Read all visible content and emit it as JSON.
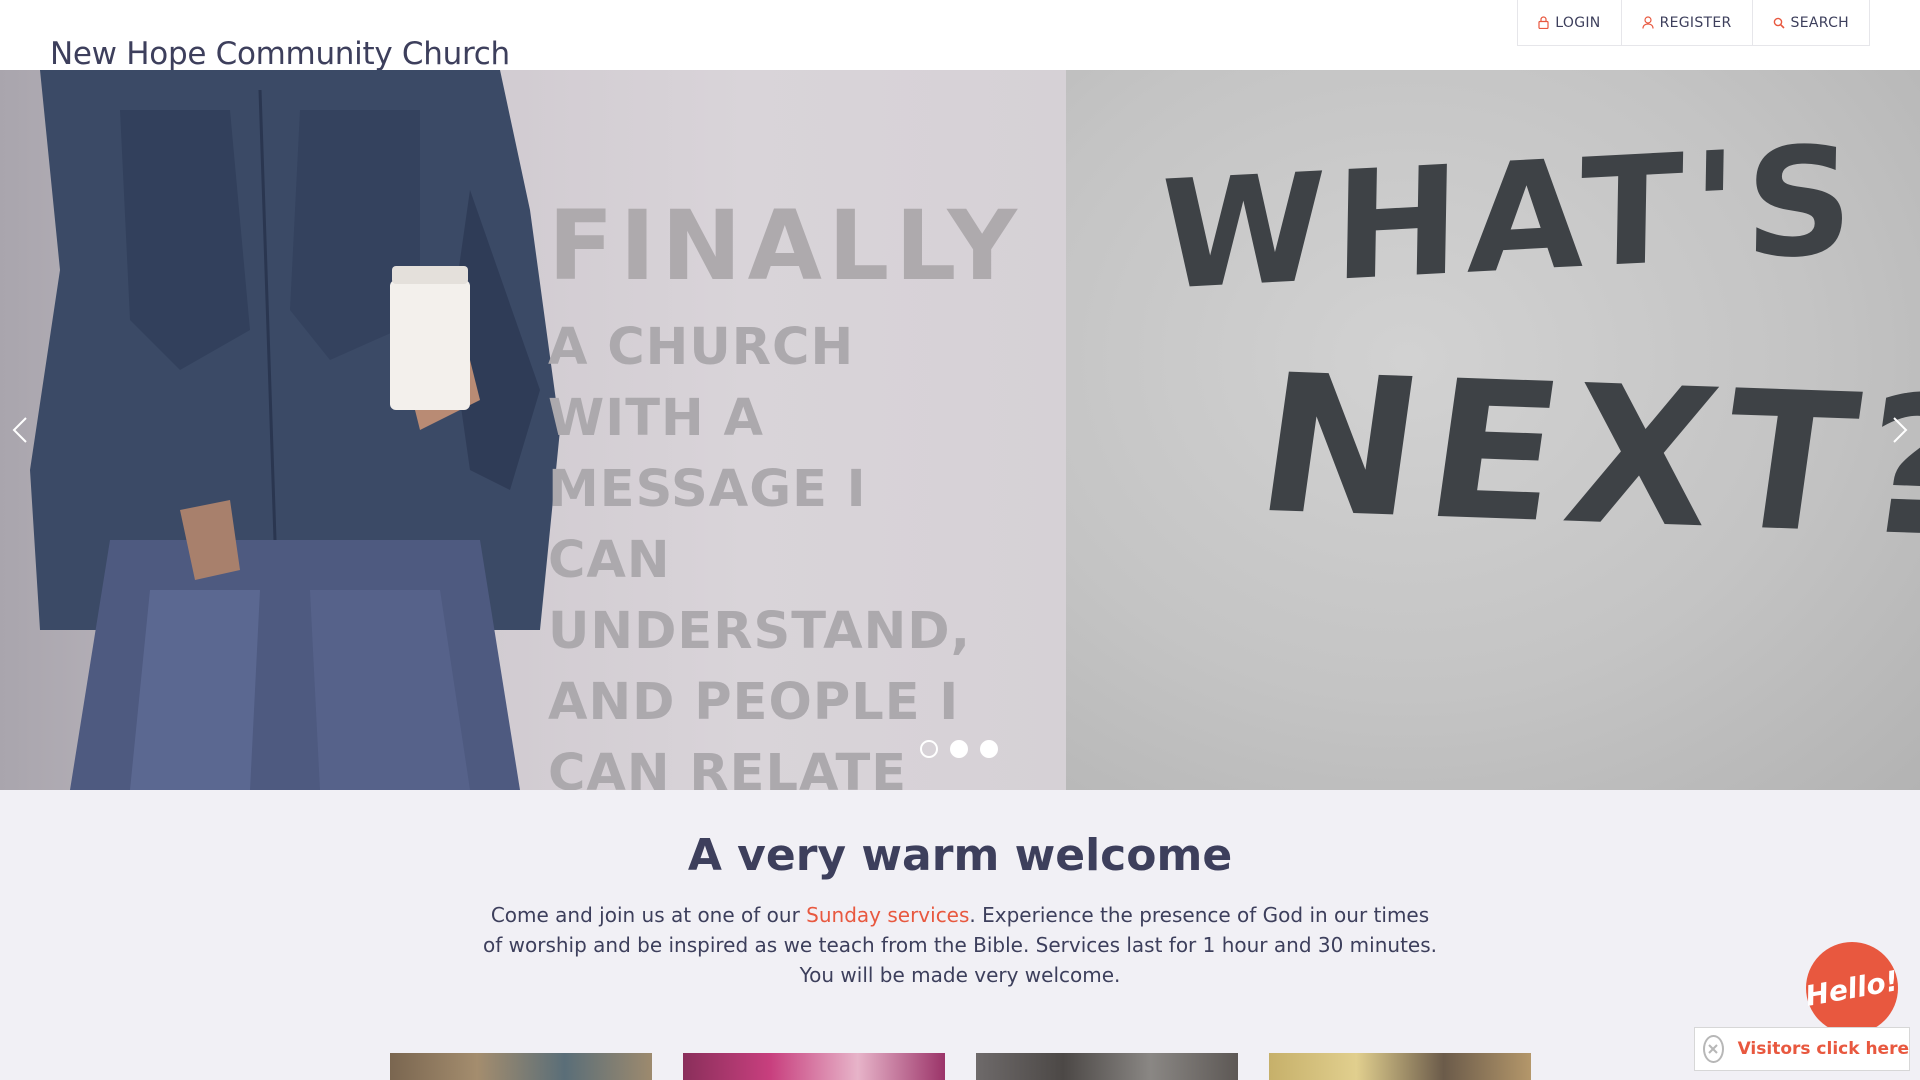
{
  "header": {
    "site_title": "New Hope Community Church",
    "top_links": [
      {
        "label": "LOGIN",
        "icon": "lock-icon"
      },
      {
        "label": "REGISTER",
        "icon": "user-icon"
      },
      {
        "label": "SEARCH",
        "icon": "search-icon"
      }
    ]
  },
  "hero": {
    "poster_heading": "FINALLY",
    "poster_body": "A CHURCH WITH A\nMESSAGE I CAN\nUNDERSTAND,\nAND PEOPLE I\nCAN RELATE TO.",
    "graffiti_line1": "WHAT'S",
    "graffiti_line2": "NEXT?",
    "prev_icon": "chevron-left-icon",
    "next_icon": "chevron-right-icon",
    "slide_count": 3,
    "active_slide": 1
  },
  "welcome": {
    "title": "A very warm welcome",
    "text_before": "Come and join us at one of our ",
    "link_text": "Sunday services",
    "text_after": ". Experience the presence of God in our times of worship and be inspired as we teach from the Bible. Services last for 1 hour and 30 minutes. You will be made very welcome."
  },
  "widget": {
    "hello_label": "Hello!",
    "visitors_label": "Visitors click here",
    "close_icon": "close-icon"
  },
  "colors": {
    "accent": "#e8583f",
    "text": "#3d3f5c",
    "background": "#f1f0f5"
  }
}
